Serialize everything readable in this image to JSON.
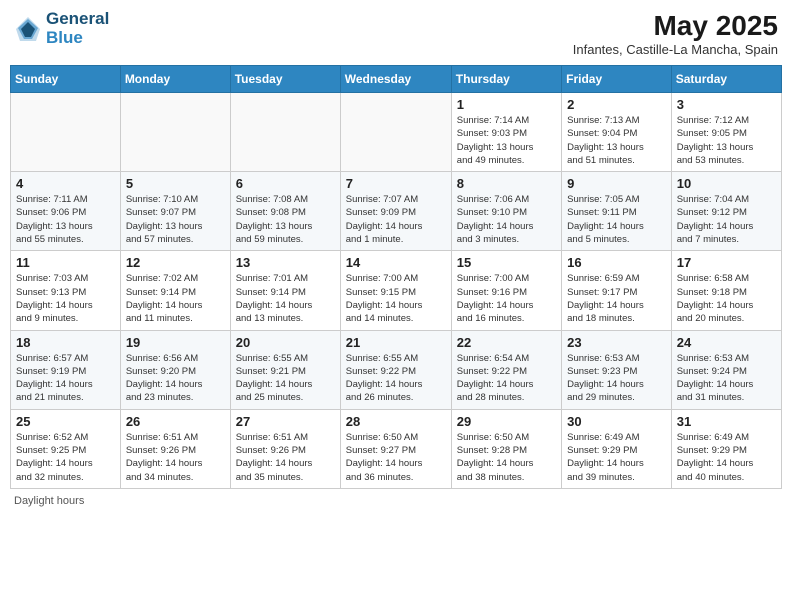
{
  "header": {
    "logo_line1": "General",
    "logo_line2": "Blue",
    "month_title": "May 2025",
    "subtitle": "Infantes, Castille-La Mancha, Spain"
  },
  "days_of_week": [
    "Sunday",
    "Monday",
    "Tuesday",
    "Wednesday",
    "Thursday",
    "Friday",
    "Saturday"
  ],
  "footer_note": "Daylight hours",
  "weeks": [
    [
      {
        "day": "",
        "info": ""
      },
      {
        "day": "",
        "info": ""
      },
      {
        "day": "",
        "info": ""
      },
      {
        "day": "",
        "info": ""
      },
      {
        "day": "1",
        "info": "Sunrise: 7:14 AM\nSunset: 9:03 PM\nDaylight: 13 hours\nand 49 minutes."
      },
      {
        "day": "2",
        "info": "Sunrise: 7:13 AM\nSunset: 9:04 PM\nDaylight: 13 hours\nand 51 minutes."
      },
      {
        "day": "3",
        "info": "Sunrise: 7:12 AM\nSunset: 9:05 PM\nDaylight: 13 hours\nand 53 minutes."
      }
    ],
    [
      {
        "day": "4",
        "info": "Sunrise: 7:11 AM\nSunset: 9:06 PM\nDaylight: 13 hours\nand 55 minutes."
      },
      {
        "day": "5",
        "info": "Sunrise: 7:10 AM\nSunset: 9:07 PM\nDaylight: 13 hours\nand 57 minutes."
      },
      {
        "day": "6",
        "info": "Sunrise: 7:08 AM\nSunset: 9:08 PM\nDaylight: 13 hours\nand 59 minutes."
      },
      {
        "day": "7",
        "info": "Sunrise: 7:07 AM\nSunset: 9:09 PM\nDaylight: 14 hours\nand 1 minute."
      },
      {
        "day": "8",
        "info": "Sunrise: 7:06 AM\nSunset: 9:10 PM\nDaylight: 14 hours\nand 3 minutes."
      },
      {
        "day": "9",
        "info": "Sunrise: 7:05 AM\nSunset: 9:11 PM\nDaylight: 14 hours\nand 5 minutes."
      },
      {
        "day": "10",
        "info": "Sunrise: 7:04 AM\nSunset: 9:12 PM\nDaylight: 14 hours\nand 7 minutes."
      }
    ],
    [
      {
        "day": "11",
        "info": "Sunrise: 7:03 AM\nSunset: 9:13 PM\nDaylight: 14 hours\nand 9 minutes."
      },
      {
        "day": "12",
        "info": "Sunrise: 7:02 AM\nSunset: 9:14 PM\nDaylight: 14 hours\nand 11 minutes."
      },
      {
        "day": "13",
        "info": "Sunrise: 7:01 AM\nSunset: 9:14 PM\nDaylight: 14 hours\nand 13 minutes."
      },
      {
        "day": "14",
        "info": "Sunrise: 7:00 AM\nSunset: 9:15 PM\nDaylight: 14 hours\nand 14 minutes."
      },
      {
        "day": "15",
        "info": "Sunrise: 7:00 AM\nSunset: 9:16 PM\nDaylight: 14 hours\nand 16 minutes."
      },
      {
        "day": "16",
        "info": "Sunrise: 6:59 AM\nSunset: 9:17 PM\nDaylight: 14 hours\nand 18 minutes."
      },
      {
        "day": "17",
        "info": "Sunrise: 6:58 AM\nSunset: 9:18 PM\nDaylight: 14 hours\nand 20 minutes."
      }
    ],
    [
      {
        "day": "18",
        "info": "Sunrise: 6:57 AM\nSunset: 9:19 PM\nDaylight: 14 hours\nand 21 minutes."
      },
      {
        "day": "19",
        "info": "Sunrise: 6:56 AM\nSunset: 9:20 PM\nDaylight: 14 hours\nand 23 minutes."
      },
      {
        "day": "20",
        "info": "Sunrise: 6:55 AM\nSunset: 9:21 PM\nDaylight: 14 hours\nand 25 minutes."
      },
      {
        "day": "21",
        "info": "Sunrise: 6:55 AM\nSunset: 9:22 PM\nDaylight: 14 hours\nand 26 minutes."
      },
      {
        "day": "22",
        "info": "Sunrise: 6:54 AM\nSunset: 9:22 PM\nDaylight: 14 hours\nand 28 minutes."
      },
      {
        "day": "23",
        "info": "Sunrise: 6:53 AM\nSunset: 9:23 PM\nDaylight: 14 hours\nand 29 minutes."
      },
      {
        "day": "24",
        "info": "Sunrise: 6:53 AM\nSunset: 9:24 PM\nDaylight: 14 hours\nand 31 minutes."
      }
    ],
    [
      {
        "day": "25",
        "info": "Sunrise: 6:52 AM\nSunset: 9:25 PM\nDaylight: 14 hours\nand 32 minutes."
      },
      {
        "day": "26",
        "info": "Sunrise: 6:51 AM\nSunset: 9:26 PM\nDaylight: 14 hours\nand 34 minutes."
      },
      {
        "day": "27",
        "info": "Sunrise: 6:51 AM\nSunset: 9:26 PM\nDaylight: 14 hours\nand 35 minutes."
      },
      {
        "day": "28",
        "info": "Sunrise: 6:50 AM\nSunset: 9:27 PM\nDaylight: 14 hours\nand 36 minutes."
      },
      {
        "day": "29",
        "info": "Sunrise: 6:50 AM\nSunset: 9:28 PM\nDaylight: 14 hours\nand 38 minutes."
      },
      {
        "day": "30",
        "info": "Sunrise: 6:49 AM\nSunset: 9:29 PM\nDaylight: 14 hours\nand 39 minutes."
      },
      {
        "day": "31",
        "info": "Sunrise: 6:49 AM\nSunset: 9:29 PM\nDaylight: 14 hours\nand 40 minutes."
      }
    ]
  ]
}
